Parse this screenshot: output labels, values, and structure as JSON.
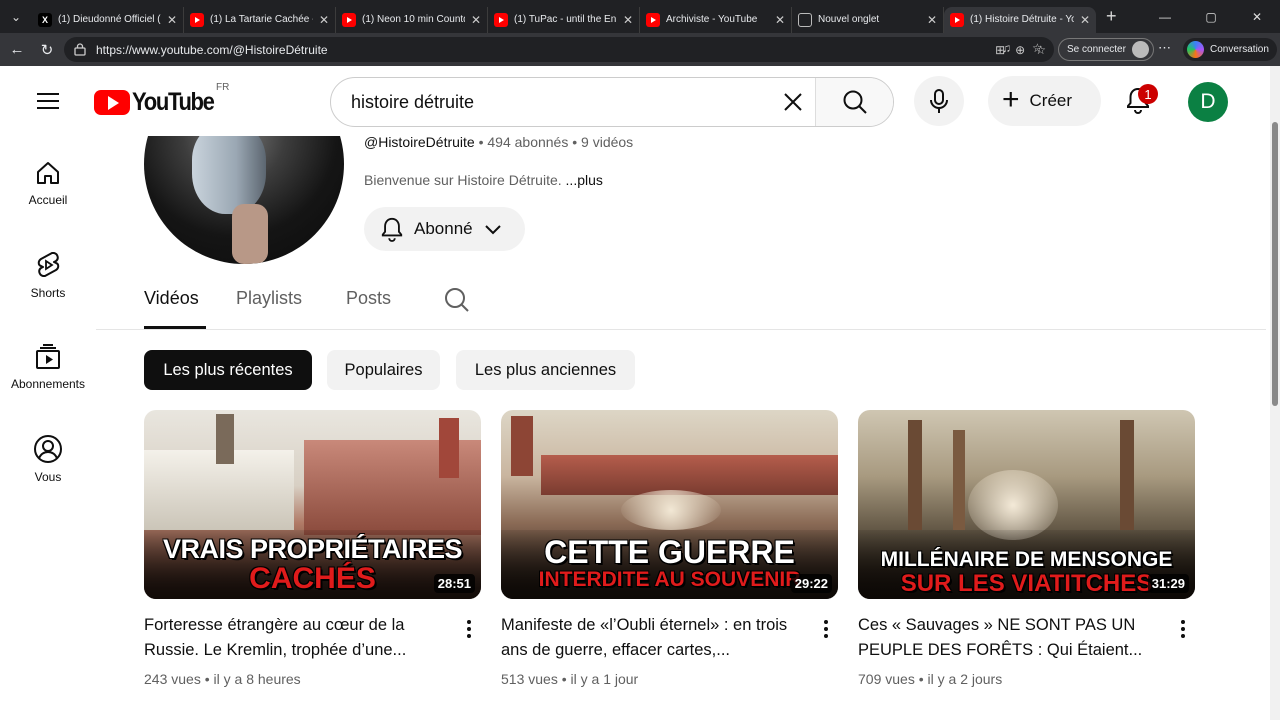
{
  "browser": {
    "tabs": [
      {
        "title": "(1) Dieudonné Officiel (",
        "icon": "x-icon"
      },
      {
        "title": "(1) La Tartarie Cachée -",
        "icon": "youtube-icon"
      },
      {
        "title": "(1) Neon 10 min Countd",
        "icon": "youtube-icon"
      },
      {
        "title": "(1) TuPac - until the En",
        "icon": "youtube-icon"
      },
      {
        "title": "Archiviste - YouTube",
        "icon": "youtube-icon"
      },
      {
        "title": "Nouvel onglet",
        "icon": "newtab-icon"
      },
      {
        "title": "(1) Histoire Détruite - Yo",
        "icon": "youtube-icon",
        "active": true
      }
    ],
    "url": "https://www.youtube.com/@HistoireDétruite",
    "signin_label": "Se connecter",
    "copilot_label": "Conversation"
  },
  "header": {
    "logo_text": "YouTube",
    "country_code": "FR",
    "search_query": "histoire détruite",
    "create_label": "Créer",
    "notification_count": "1",
    "user_initial": "D"
  },
  "sidebar": {
    "items": [
      {
        "label": "Accueil",
        "icon": "home-icon"
      },
      {
        "label": "Shorts",
        "icon": "shorts-icon"
      },
      {
        "label": "Abonnements",
        "icon": "subscriptions-icon"
      },
      {
        "label": "Vous",
        "icon": "user-icon"
      }
    ]
  },
  "channel": {
    "handle": "@HistoireDétruite",
    "subscribers": "494 abonnés",
    "video_count": "9 vidéos",
    "description": "Bienvenue sur Histoire Détruite.",
    "more_label": "...plus",
    "subscribe_label": "Abonné"
  },
  "tabs": [
    "Vidéos",
    "Playlists",
    "Posts"
  ],
  "filters": [
    "Les plus récentes",
    "Populaires",
    "Les plus anciennes"
  ],
  "videos": [
    {
      "title": "Forteresse étrangère au cœur de la Russie. Le Kremlin, trophée d’une...",
      "views": "243 vues",
      "age": "il y a 8 heures",
      "duration": "28:51",
      "thumb_line1": "VRAIS PROPRIÉTAIRES",
      "thumb_line2": "CACHÉS"
    },
    {
      "title": "Manifeste de «l’Oubli éternel» : en trois ans de guerre, effacer cartes,...",
      "views": "513 vues",
      "age": "il y a 1 jour",
      "duration": "29:22",
      "thumb_line1": "CETTE GUERRE",
      "thumb_line2": "INTERDITE AU SOUVENIR"
    },
    {
      "title": "Ces « Sauvages » NE SONT PAS UN PEUPLE DES FORÊTS : Qui Étaient...",
      "views": "709 vues",
      "age": "il y a 2 jours",
      "duration": "31:29",
      "thumb_line1": "MILLÉNAIRE DE MENSONGE",
      "thumb_line2": "SUR LES VIATITCHES"
    }
  ],
  "separator": "•"
}
